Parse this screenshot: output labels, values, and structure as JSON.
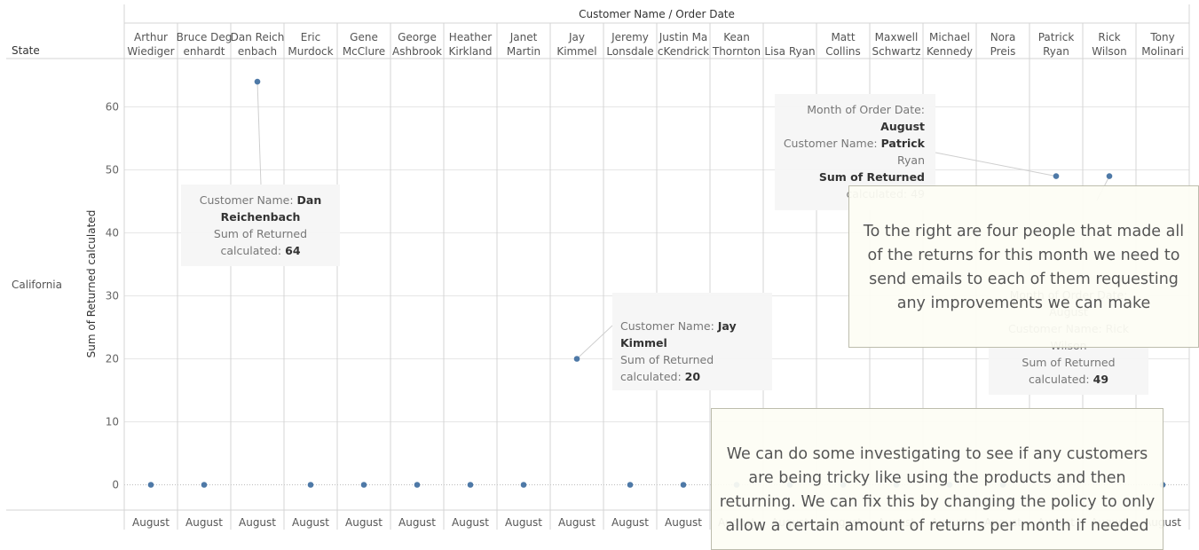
{
  "chart_data": {
    "type": "scatter",
    "title": "",
    "column_header": "Customer Name / Order Date",
    "row_header": "State",
    "row_label": "California",
    "ylabel": "Sum of Returned calculated",
    "yticks": [
      0,
      10,
      20,
      30,
      40,
      50,
      60
    ],
    "ylim": [
      0,
      66
    ],
    "grid": true,
    "categories": [
      [
        "Arthur",
        "Wiediger"
      ],
      [
        "Bruce Deg",
        "enhardt"
      ],
      [
        "Dan Reich",
        "enbach"
      ],
      [
        "Eric",
        "Murdock"
      ],
      [
        "Gene",
        "McClure"
      ],
      [
        "George",
        "Ashbrook"
      ],
      [
        "Heather",
        "Kirkland"
      ],
      [
        "Janet",
        "Martin"
      ],
      [
        "Jay",
        "Kimmel"
      ],
      [
        "Jeremy",
        "Lonsdale"
      ],
      [
        "Justin Ma",
        "cKendrick"
      ],
      [
        "Kean",
        "Thornton"
      ],
      [
        "Lisa Ryan"
      ],
      [
        "Matt",
        "Collins"
      ],
      [
        "Maxwell",
        "Schwartz"
      ],
      [
        "Michael",
        "Kennedy"
      ],
      [
        "Nora",
        "Preis"
      ],
      [
        "Patrick",
        "Ryan"
      ],
      [
        "Rick",
        "Wilson"
      ],
      [
        "Tony",
        "Molinari"
      ]
    ],
    "month_label": "August",
    "series": [
      {
        "values": [
          0,
          0,
          64,
          0,
          0,
          0,
          0,
          0,
          20,
          0,
          0,
          0,
          0,
          0,
          0,
          0,
          0,
          49,
          49,
          0
        ]
      }
    ],
    "colors": {
      "point": "#4e79a7",
      "grid": "#e6e6e6",
      "separator": "#d4d4d4",
      "zero_line": "#bbbbbb"
    }
  },
  "tooltips": [
    {
      "id": "dan",
      "lines": [
        [
          {
            "t": "Customer Name: "
          },
          {
            "t": "Dan",
            "b": true
          }
        ],
        [
          {
            "t": "Reichenbach",
            "b": true
          }
        ],
        [
          {
            "t": "Sum of Returned"
          }
        ],
        [
          {
            "t": "calculated: "
          },
          {
            "t": "64",
            "b": true
          }
        ]
      ]
    },
    {
      "id": "jay",
      "lines": [
        [
          {
            "t": "Customer Name: "
          },
          {
            "t": "Jay",
            "b": true
          }
        ],
        [
          {
            "t": "Kimmel",
            "b": true
          }
        ],
        [
          {
            "t": "Sum of Returned"
          }
        ],
        [
          {
            "t": "calculated: "
          },
          {
            "t": "20",
            "b": true
          }
        ]
      ]
    },
    {
      "id": "patrick",
      "lines": [
        [
          {
            "t": "Month of Order Date:"
          }
        ],
        [
          {
            "t": "August",
            "b": true
          }
        ],
        [
          {
            "t": "Customer Name: "
          },
          {
            "t": "Patrick",
            "b": true
          }
        ],
        [
          {
            "t": "Ryan"
          }
        ],
        [
          {
            "t": "Sum of Returned",
            "b": true
          }
        ],
        [
          {
            "t": "calculated: 49"
          }
        ]
      ]
    },
    {
      "id": "rick",
      "lines": [
        [
          {
            "t": "Month of Order Date:"
          }
        ],
        [
          {
            "t": "August"
          }
        ],
        [
          {
            "t": "Customer Name: "
          },
          {
            "t": "Rick"
          }
        ],
        [
          {
            "t": "Wilson"
          }
        ],
        [
          {
            "t": "Sum of Returned"
          }
        ],
        [
          {
            "t": "calculated: "
          },
          {
            "t": "49",
            "b": true
          }
        ]
      ]
    }
  ],
  "annotations": [
    {
      "id": "four-people",
      "text": "To the right are four people that made all of the returns for this month we need to  send emails to each of them requesting any improvements we can make"
    },
    {
      "id": "investigate",
      "text": "We can do some investigating to see if any customers are being tricky like using the products and then returning. We can fix this by changing the policy to only allow a certain amount of returns per month if needed"
    }
  ]
}
